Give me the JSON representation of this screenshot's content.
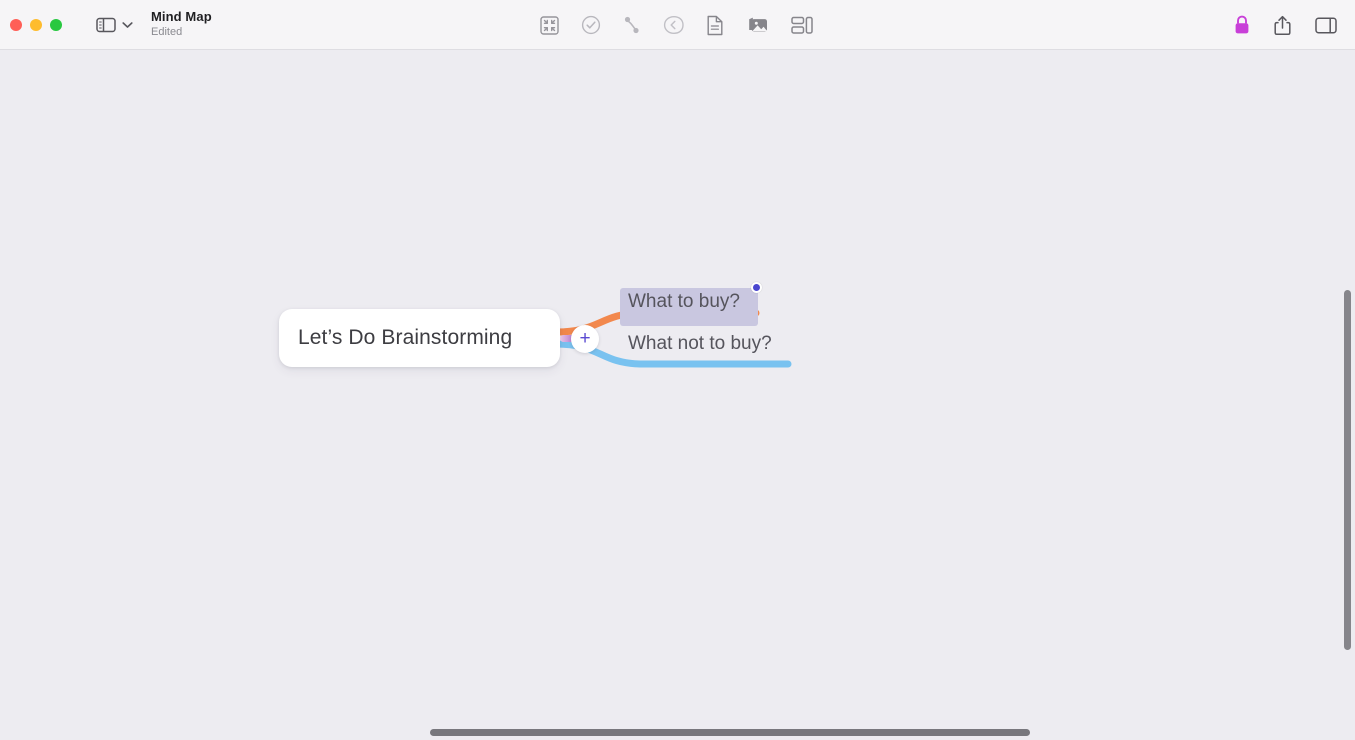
{
  "window": {
    "title": "Mind Map",
    "subtitle": "Edited",
    "traffic_lights": [
      {
        "name": "close",
        "color": "#ff5f57"
      },
      {
        "name": "minimize",
        "color": "#febc2e"
      },
      {
        "name": "maximize",
        "color": "#28c840"
      }
    ]
  },
  "toolbar": {
    "sidebar_toggle": "sidebar-icon",
    "sidebar_chevron": "chevron-down-icon",
    "center_items": [
      {
        "name": "focus-icon",
        "label": "Focus"
      },
      {
        "name": "checkmark-circle-icon",
        "label": "Mark Complete"
      },
      {
        "name": "connection-icon",
        "label": "Connection"
      },
      {
        "name": "back-arrow-icon",
        "label": "Back"
      },
      {
        "name": "document-icon",
        "label": "Note"
      },
      {
        "name": "media-icon",
        "label": "Media"
      },
      {
        "name": "layout-icon",
        "label": "Layout"
      }
    ],
    "right_items": [
      {
        "name": "lock-icon",
        "label": "Lock",
        "color": "#c83fd8"
      },
      {
        "name": "share-icon",
        "label": "Share",
        "color": "#58575d"
      },
      {
        "name": "inspector-icon",
        "label": "Inspector",
        "color": "#58575d"
      }
    ]
  },
  "canvas": {
    "background": "#edecf1",
    "root_node": {
      "label": "Let’s Do Brainstorming",
      "background": "#ffffff",
      "text_color": "#3d3d42"
    },
    "children": [
      {
        "label": "What to buy?",
        "branch_color": "#f2884d",
        "selected": true,
        "selection_color": "#c9c7e0",
        "handle_color": "#4a46cf"
      },
      {
        "label": "What not to buy?",
        "branch_color": "#79c2f0",
        "selected": false
      }
    ],
    "add_button": {
      "label": "+",
      "color": "#5a4ad1"
    }
  },
  "scrollbars": {
    "vertical": "#86858b",
    "horizontal": "#78777d"
  }
}
